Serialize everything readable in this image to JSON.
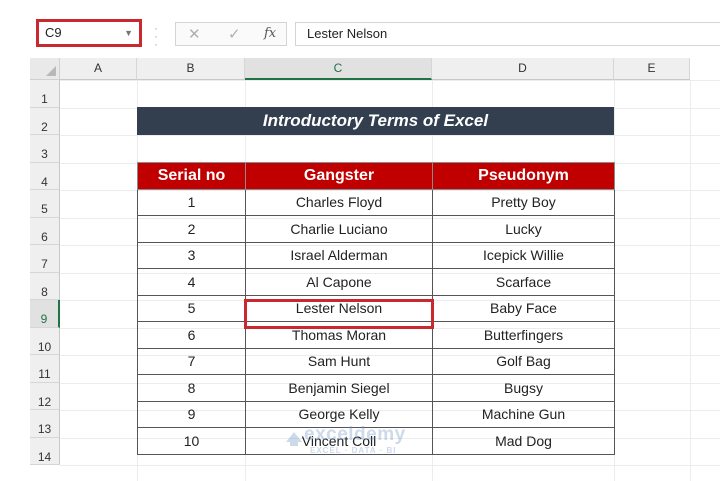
{
  "formula_bar": {
    "name_box": "C9",
    "cancel_icon": "✕",
    "enter_icon": "✓",
    "fx_label": "fx",
    "formula_value": "Lester Nelson"
  },
  "columns": [
    "A",
    "B",
    "C",
    "D",
    "E"
  ],
  "selected_column": "C",
  "rows": [
    "1",
    "2",
    "3",
    "4",
    "5",
    "6",
    "7",
    "8",
    "9",
    "10",
    "11",
    "12",
    "13",
    "14"
  ],
  "selected_row": "9",
  "sheet": {
    "title": "Introductory Terms of Excel",
    "headers": [
      "Serial no",
      "Gangster",
      "Pseudonym"
    ],
    "records": [
      [
        "1",
        "Charles Floyd",
        "Pretty Boy"
      ],
      [
        "2",
        "Charlie Luciano",
        "Lucky"
      ],
      [
        "3",
        "Israel Alderman",
        "Icepick Willie"
      ],
      [
        "4",
        "Al Capone",
        "Scarface"
      ],
      [
        "5",
        "Lester Nelson",
        "Baby Face"
      ],
      [
        "6",
        "Thomas Moran",
        "Butterfingers"
      ],
      [
        "7",
        "Sam Hunt",
        "Golf Bag"
      ],
      [
        "8",
        "Benjamin Siegel",
        "Bugsy"
      ],
      [
        "9",
        "George Kelly",
        "Machine Gun"
      ],
      [
        "10",
        "Vincent Coll",
        "Mad Dog"
      ]
    ],
    "header_color": "#c00000",
    "title_color": "#333f4f",
    "highlight_color": "#c8282e"
  },
  "watermark": {
    "brand": "exceldemy",
    "tagline": "EXCEL · DATA · BI"
  }
}
